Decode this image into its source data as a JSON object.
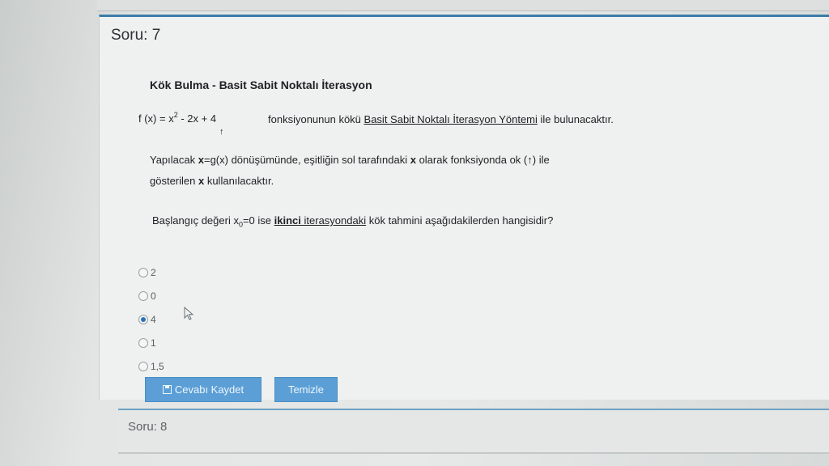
{
  "question": {
    "number_label": "Soru: 7",
    "heading": "Kök Bulma - Basit Sabit Noktalı İterasyon",
    "formula": {
      "prefix": "f (x) = x",
      "exponent": "2",
      "suffix": " - 2x + 4",
      "arrow": "↑"
    },
    "description": {
      "part1": "fonksiyonunun kökü ",
      "method": "Basit Sabit Noktalı İterasyon Yöntemi",
      "part2": " ile bulunacaktır."
    },
    "instruction": {
      "t1": "Yapılacak ",
      "b1": "x",
      "t2": "=g(x) dönüşümünde, eşitliğin sol tarafındaki ",
      "b2": "x",
      "t3": " olarak fonksiyonda ok (",
      "arrow": "↑",
      "t4": ") ile",
      "t5": "gösterilen ",
      "b3": "x",
      "t6": " kullanılacaktır."
    },
    "prompt": {
      "t1": "Başlangıç değeri x",
      "sub": "0",
      "t2": "=0 ise ",
      "bold_u": "ikinci",
      "space": " ",
      "u": "iterasyondaki",
      "t3": " kök tahmini aşağıdakilerden  hangisidir?"
    },
    "options": [
      {
        "label": "2",
        "checked": false
      },
      {
        "label": "0",
        "checked": false
      },
      {
        "label": "4",
        "checked": true
      },
      {
        "label": "1",
        "checked": false
      },
      {
        "label": "1,5",
        "checked": false
      }
    ],
    "save_button": "Cevabı Kaydet",
    "clear_button": "Temizle"
  },
  "next_question": {
    "number_label": "Soru: 8"
  },
  "colors": {
    "accent": "#3a7ca8",
    "button": "#5b9fd6",
    "radio_checked": "#2d6fb5"
  }
}
